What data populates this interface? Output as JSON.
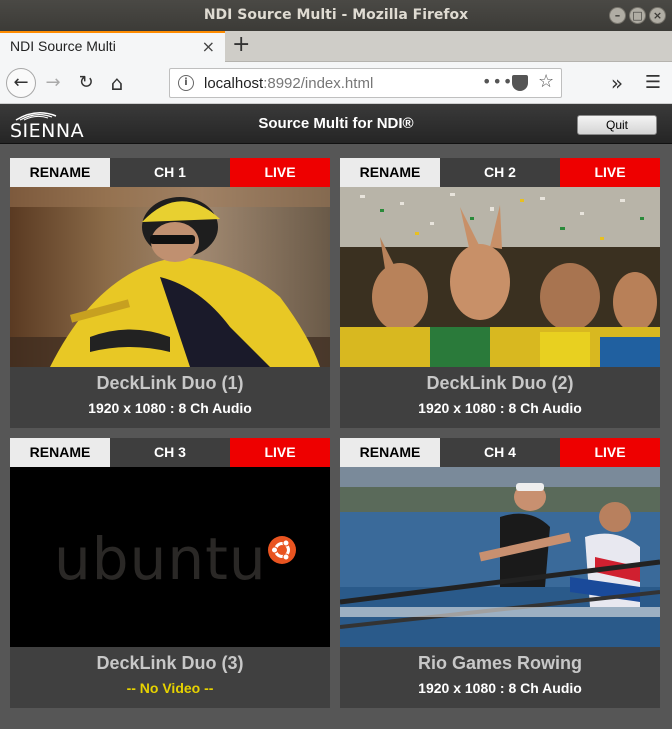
{
  "window": {
    "title": "NDI Source Multi - Mozilla Firefox",
    "minimize_glyph": "–",
    "maximize_glyph": "□",
    "close_glyph": "×"
  },
  "browser": {
    "tab_title": "NDI Source Multi",
    "tab_close_glyph": "×",
    "new_tab_glyph": "+",
    "back_glyph": "←",
    "forward_glyph": "→",
    "reload_glyph": "↻",
    "home_glyph": "⌂",
    "url_host": "localhost",
    "url_rest": ":8992/index.html",
    "page_actions_glyph": "•••",
    "bookmark_glyph": "☆",
    "overflow_glyph": "»",
    "menu_glyph": "☰",
    "icons": [
      "back-icon",
      "forward-icon",
      "reload-icon",
      "home-icon",
      "info-icon",
      "pocket-icon",
      "star-icon",
      "overflow-icon",
      "menu-icon"
    ]
  },
  "app": {
    "logo_text": "SIENNA",
    "title": "Source Multi for NDI®",
    "quit_label": "Quit"
  },
  "channels": [
    {
      "rename_label": "RENAME",
      "channel_label": "CH 1",
      "live_label": "LIVE",
      "name": "DeckLink Duo (1)",
      "info": "1920 x 1080 : 8 Ch Audio"
    },
    {
      "rename_label": "RENAME",
      "channel_label": "CH 2",
      "live_label": "LIVE",
      "name": "DeckLink Duo (2)",
      "info": "1920 x 1080 : 8 Ch Audio"
    },
    {
      "rename_label": "RENAME",
      "channel_label": "CH 3",
      "live_label": "LIVE",
      "name": "DeckLink Duo (3)",
      "info": "-- No Video --",
      "preview_text": "ubuntu"
    },
    {
      "rename_label": "RENAME",
      "channel_label": "CH 4",
      "live_label": "LIVE",
      "name": "Rio Games Rowing",
      "info": "1920 x 1080 : 8 Ch Audio"
    }
  ],
  "colors": {
    "live": "#ee0000",
    "rename": "#ebebeb",
    "no_video": "#e6d200",
    "ubuntu_orange": "#e95420"
  }
}
